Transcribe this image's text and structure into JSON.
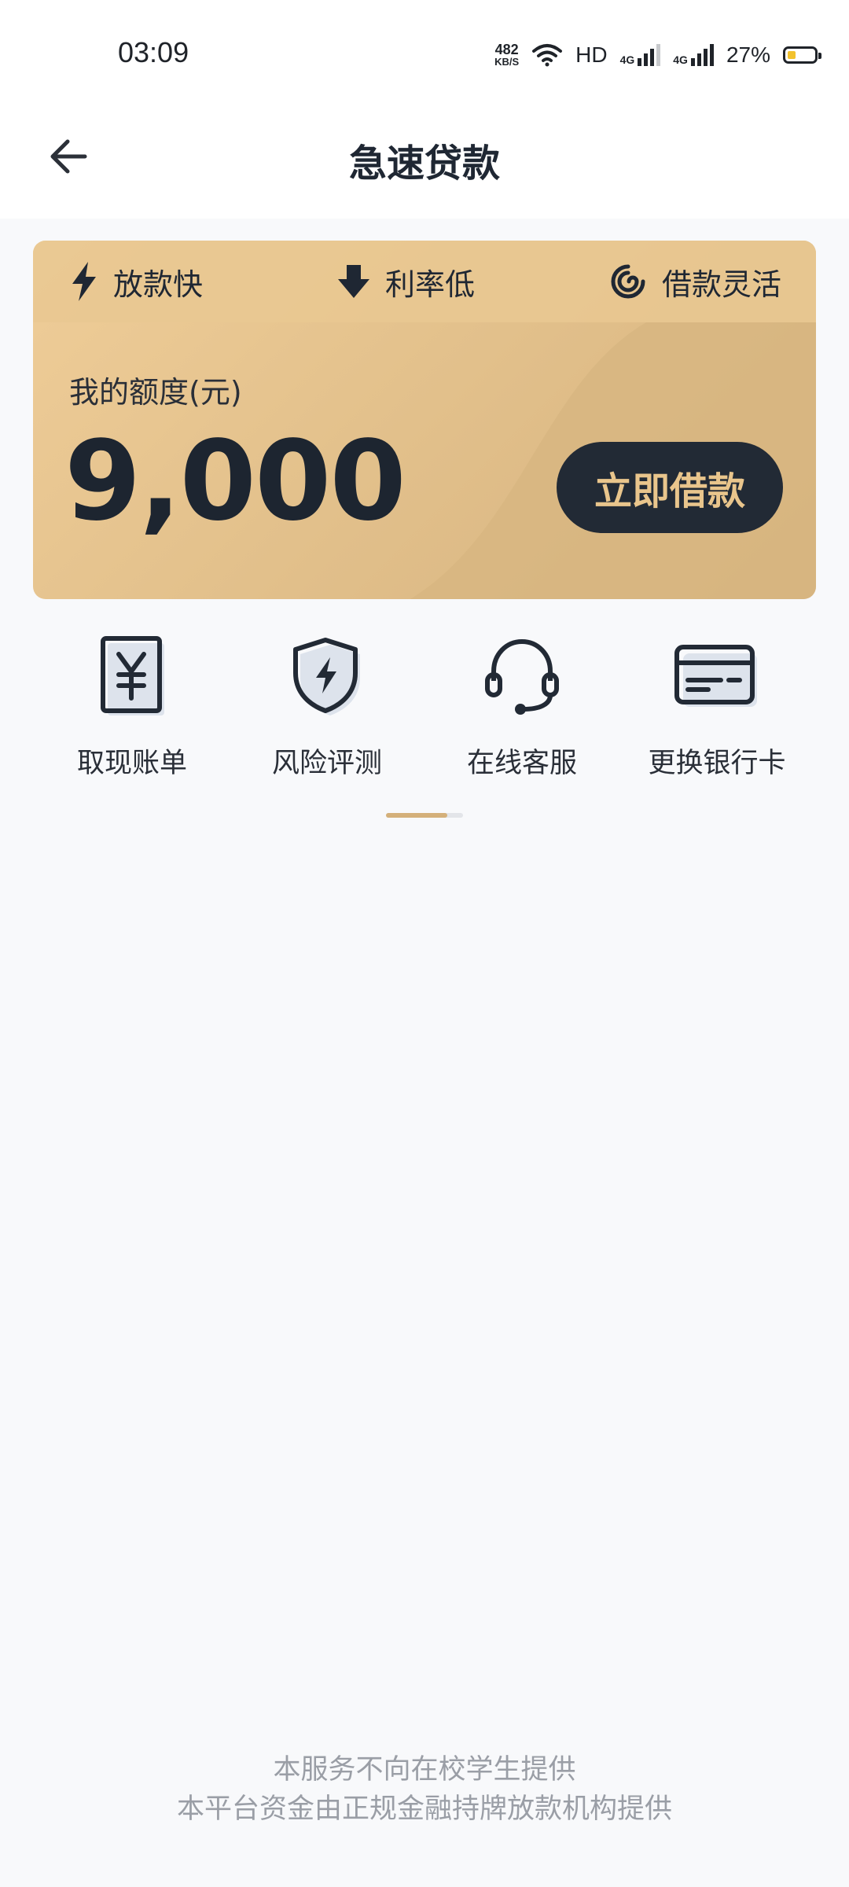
{
  "status_bar": {
    "time": "03:09",
    "net_speed_value": "482",
    "net_speed_unit": "KB/S",
    "hd_label": "HD",
    "signal1_label": "4G",
    "signal2_label": "4G",
    "battery_percent": "27%",
    "battery_level": 0.27
  },
  "navbar": {
    "title": "急速贷款"
  },
  "card": {
    "features": [
      {
        "label": "放款快",
        "icon": "lightning-icon"
      },
      {
        "label": "利率低",
        "icon": "arrow-down-icon"
      },
      {
        "label": "借款灵活",
        "icon": "spiral-icon"
      }
    ],
    "quota_label": "我的额度(元)",
    "quota_amount": "9,000",
    "borrow_button": "立即借款",
    "accent_color": "#222a35",
    "card_color": "#e3c18c"
  },
  "services": [
    {
      "label": "取现账单",
      "icon": "yuan-bill-icon"
    },
    {
      "label": "风险评测",
      "icon": "shield-lightning-icon"
    },
    {
      "label": "在线客服",
      "icon": "headset-icon"
    },
    {
      "label": "更换银行卡",
      "icon": "bank-card-icon"
    }
  ],
  "footer": {
    "line1": "本服务不向在校学生提供",
    "line2": "本平台资金由正规金融持牌放款机构提供"
  }
}
